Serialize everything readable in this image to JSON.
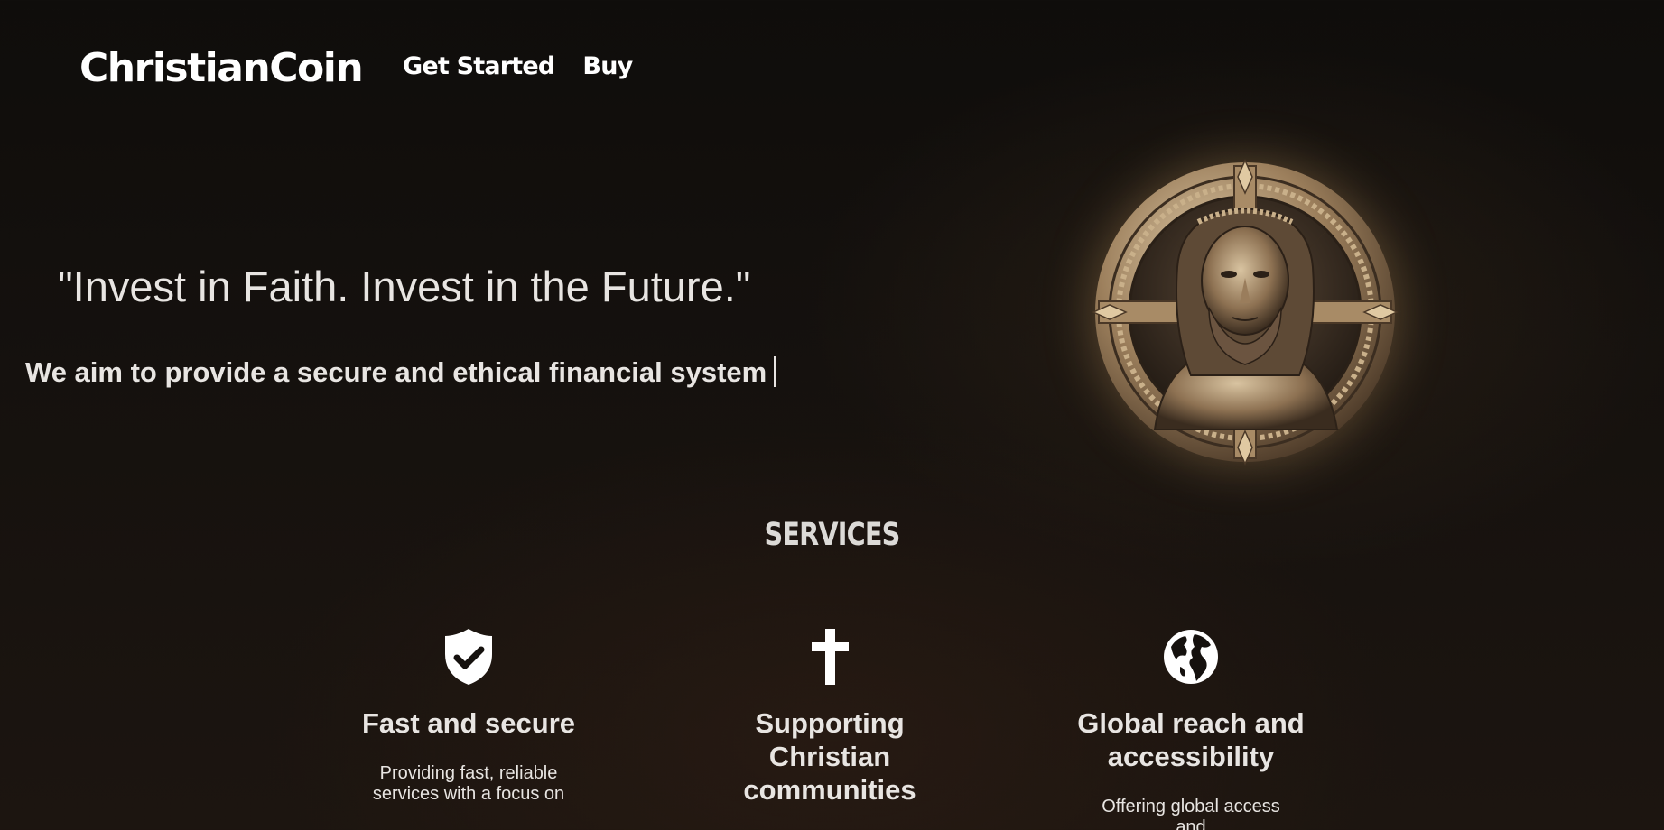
{
  "header": {
    "logo": "ChristianCoin",
    "nav": [
      {
        "label": "Get Started"
      },
      {
        "label": "Buy"
      }
    ]
  },
  "hero": {
    "tagline": "\"Invest in Faith. Invest in the Future.\"",
    "mission": "We aim to provide a secure and ethical financial system",
    "coin_image": "jesus-coin-image"
  },
  "services": {
    "title": "SERVICES",
    "items": [
      {
        "icon": "shield-check-icon",
        "title": "Fast and secure",
        "description": "Providing fast, reliable services with a focus on"
      },
      {
        "icon": "cross-icon",
        "title": "Supporting Christian communities",
        "description": ""
      },
      {
        "icon": "globe-icon",
        "title": "Global reach and accessibility",
        "description": "Offering global access and"
      }
    ]
  },
  "colors": {
    "background": "#120f0c",
    "text": "#e8e5e2",
    "coin_gold": "#b89a72"
  }
}
